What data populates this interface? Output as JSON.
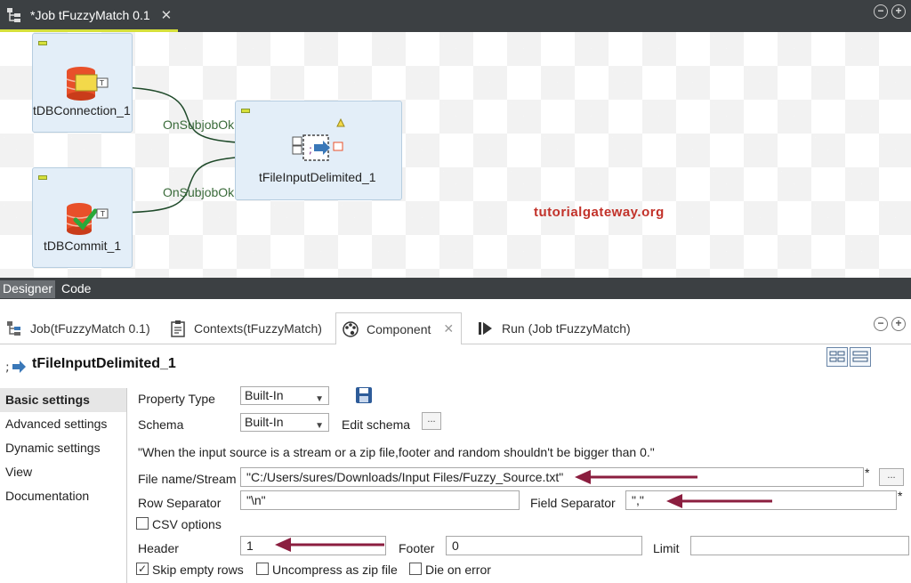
{
  "editor_tab": {
    "title": "*Job tFuzzyMatch 0.1",
    "close": "✕"
  },
  "window_buttons": {
    "minimize": "−",
    "maximize": "+"
  },
  "canvas": {
    "components": [
      {
        "label": "tDBConnection_1"
      },
      {
        "label": "tDBCommit_1"
      },
      {
        "label": "tFileInputDelimited_1"
      }
    ],
    "links": [
      {
        "label": "OnSubjobOk"
      },
      {
        "label": "OnSubjobOk"
      }
    ],
    "watermark": "tutorialgateway.org"
  },
  "view_tabs": {
    "designer": "Designer",
    "code": "Code"
  },
  "panel_tabs": [
    {
      "label": "Job(tFuzzyMatch 0.1)"
    },
    {
      "label": "Contexts(tFuzzyMatch)"
    },
    {
      "label": "Component",
      "close": "✕"
    },
    {
      "label": "Run (Job tFuzzyMatch)"
    }
  ],
  "component_header": {
    "name": "tFileInputDelimited_1"
  },
  "sidenav": {
    "items": [
      "Basic settings",
      "Advanced settings",
      "Dynamic settings",
      "View",
      "Documentation"
    ],
    "active": "Basic settings"
  },
  "settings": {
    "property_type_label": "Property Type",
    "property_type_value": "Built-In",
    "schema_label": "Schema",
    "schema_value": "Built-In",
    "edit_schema_label": "Edit schema",
    "ellipsis": "...",
    "note": "\"When the input source is a stream or a zip file,footer and random shouldn't be bigger than 0.\"",
    "file_name_label": "File name/Stream",
    "file_name_value": "\"C:/Users/sures/Downloads/Input Files/Fuzzy_Source.txt\"",
    "required_mark": "*",
    "row_separator_label": "Row Separator",
    "row_separator_value": "\"\\n\"",
    "field_separator_label": "Field Separator",
    "field_separator_value": "\",\"",
    "csv_options_label": "CSV options",
    "header_label": "Header",
    "header_value": "1",
    "footer_label": "Footer",
    "footer_value": "0",
    "limit_label": "Limit",
    "limit_value": "",
    "skip_empty_rows_label": "Skip empty rows",
    "uncompress_label": "Uncompress as zip file",
    "die_on_error_label": "Die on error",
    "check_mark": "✓"
  },
  "colors": {
    "accent": "#d6e03a",
    "annotation_arrow": "#8b1e3f",
    "dark_bar": "#3c4043"
  }
}
